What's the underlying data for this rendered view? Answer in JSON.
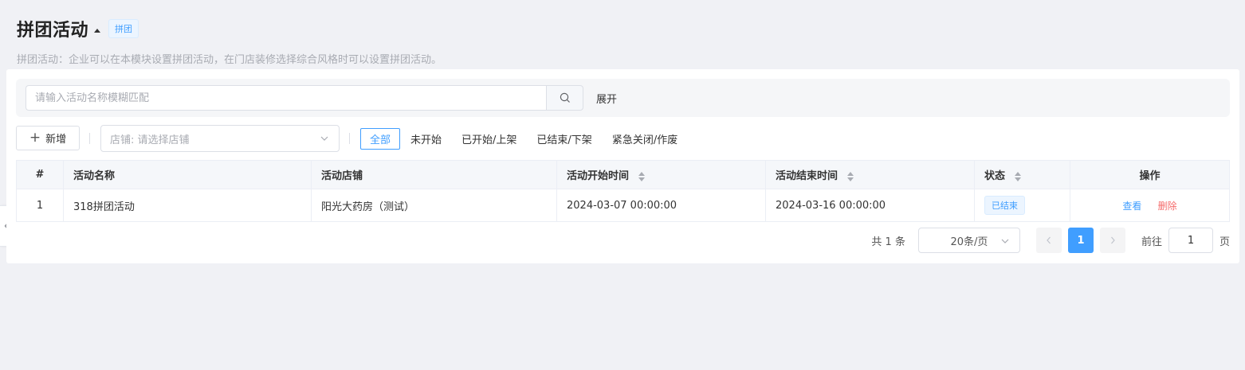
{
  "header": {
    "title": "拼团活动",
    "badge": "拼团",
    "subtitle": "拼团活动：企业可以在本模块设置拼团活动，在门店装修选择综合风格时可以设置拼团活动。"
  },
  "search": {
    "placeholder": "请输入活动名称模糊匹配",
    "value": "",
    "expand_label": "展开"
  },
  "toolbar": {
    "add_label": "新增",
    "store_select_placeholder": "店铺: 请选择店铺",
    "status_tabs": [
      {
        "label": "全部",
        "active": true
      },
      {
        "label": "未开始",
        "active": false
      },
      {
        "label": "已开始/上架",
        "active": false
      },
      {
        "label": "已结束/下架",
        "active": false
      },
      {
        "label": "紧急关闭/作废",
        "active": false
      }
    ]
  },
  "table": {
    "columns": [
      "#",
      "活动名称",
      "活动店铺",
      "活动开始时间",
      "活动结束时间",
      "状态",
      "操作"
    ],
    "rows": [
      {
        "index": "1",
        "name": "318拼团活动",
        "store": "阳光大药房（测试）",
        "start": "2024-03-07 00:00:00",
        "end": "2024-03-16 00:00:00",
        "status": "已结束",
        "actions": {
          "view": "查看",
          "delete": "删除"
        }
      }
    ]
  },
  "pagination": {
    "total_text": "共 1 条",
    "page_size": "20条/页",
    "current_page": "1",
    "goto_label": "前往",
    "goto_value": "1",
    "goto_suffix": "页"
  },
  "colors": {
    "primary": "#409eff",
    "danger": "#f56c6c",
    "background": "#f0f1f5"
  }
}
